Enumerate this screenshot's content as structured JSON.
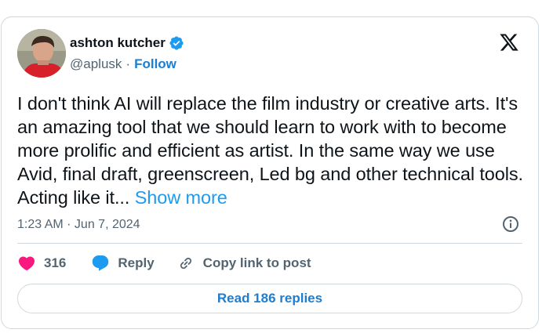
{
  "author": {
    "name": "ashton kutcher",
    "handle": "@aplusk",
    "separator": "·",
    "follow_label": "Follow",
    "verified_icon": "verified-badge-icon",
    "verified_color": "#1d9bf0"
  },
  "tweet": {
    "text": "I don't think AI will replace the film industry or creative arts. It's an amazing tool that we should learn to work with to become more prolific and efficient as artist.  In the same way we use Avid, final draft, greenscreen, Led bg and other technical tools.  Acting like it... ",
    "show_more_label": "Show more",
    "timestamp": "1:23 AM · Jun 7, 2024"
  },
  "actions": {
    "like_count": "316",
    "like_color": "#f91880",
    "reply_label": "Reply",
    "copy_label": "Copy link to post"
  },
  "replies_button": {
    "label": "Read 186 replies"
  },
  "colors": {
    "link": "#1d9bf0",
    "follow": "#1d7ed0",
    "muted": "#536471",
    "border": "#cfd9de"
  }
}
